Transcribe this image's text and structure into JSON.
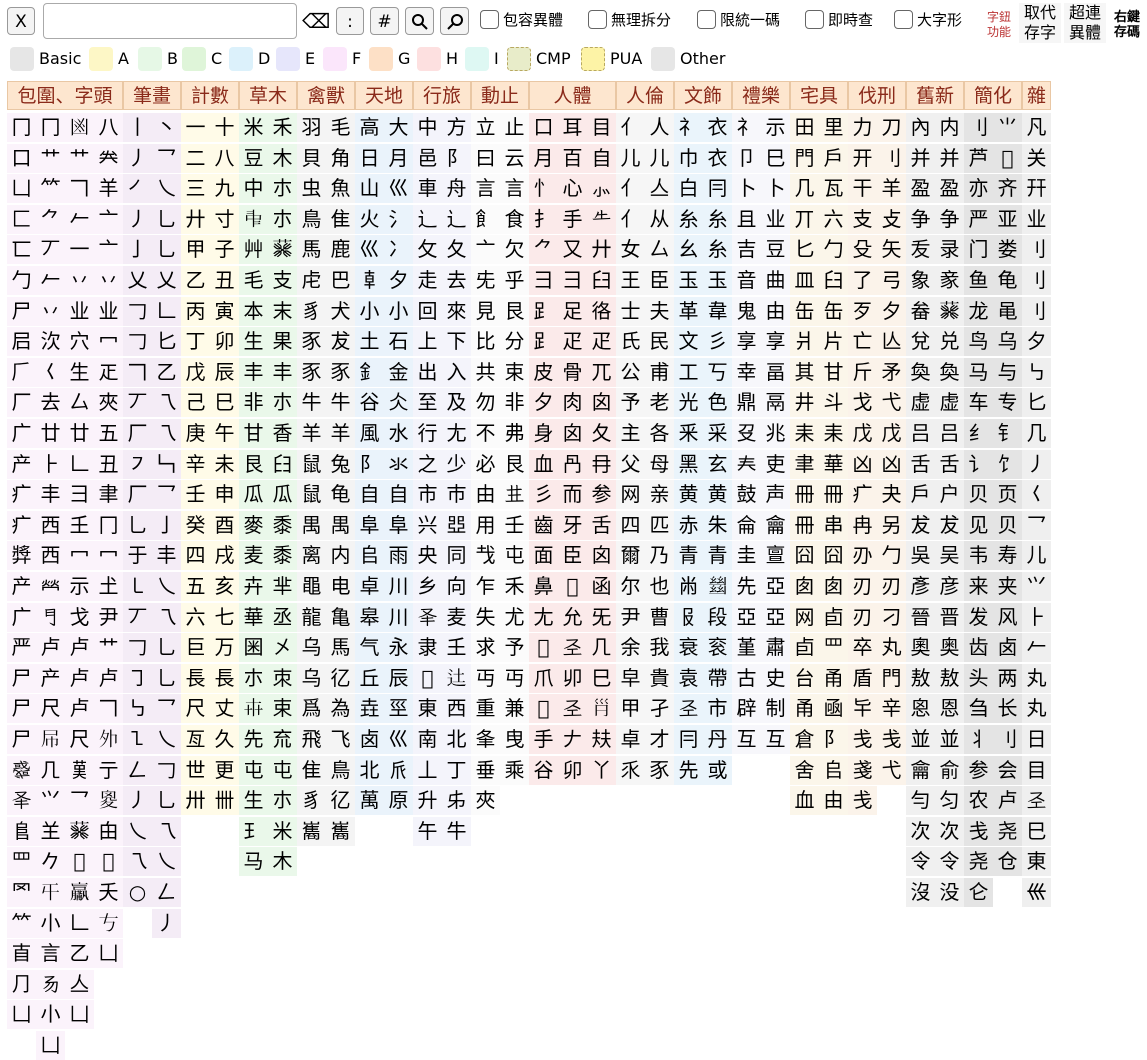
{
  "toolbar": {
    "clear_label": "X",
    "search_value": "",
    "search_placeholder": "",
    "backspace_glyph": "⌫",
    "colon_label": ":",
    "hash_label": "#",
    "search_icon": "magnifier-icon",
    "search_alt_icon": "magnifier-alt-icon",
    "options": [
      {
        "label": "包容異體",
        "checked": false
      },
      {
        "label": "無理拆分",
        "checked": false
      },
      {
        "label": "限統一碼",
        "checked": false
      },
      {
        "label": "即時查",
        "checked": false
      },
      {
        "label": "大字形",
        "checked": false
      }
    ],
    "right_buttons": {
      "func": [
        "字鈕",
        "功能"
      ],
      "replace": [
        "取代",
        "存字"
      ],
      "link": [
        "超連",
        "異體"
      ],
      "rightkey": [
        "右鍵",
        "存碼"
      ]
    }
  },
  "filters": [
    {
      "label": "Basic",
      "color": "#e6e6e6",
      "dashed": false
    },
    {
      "label": "A",
      "color": "#fdf7c6",
      "dashed": false
    },
    {
      "label": "B",
      "color": "#e6f8e6",
      "dashed": false
    },
    {
      "label": "C",
      "color": "#dff5d9",
      "dashed": false
    },
    {
      "label": "D",
      "color": "#dcf1fb",
      "dashed": false
    },
    {
      "label": "E",
      "color": "#e6e6fb",
      "dashed": false
    },
    {
      "label": "F",
      "color": "#fbe6fb",
      "dashed": false
    },
    {
      "label": "G",
      "color": "#fde0c6",
      "dashed": false
    },
    {
      "label": "H",
      "color": "#fde0e0",
      "dashed": false
    },
    {
      "label": "I",
      "color": "#def8f3",
      "dashed": false
    },
    {
      "label": "CMP",
      "color": "#e8ecc9",
      "dashed": true
    },
    {
      "label": "PUA",
      "color": "#fdf3a6",
      "dashed": true
    },
    {
      "label": "Other",
      "color": "#e6e6e6",
      "dashed": false
    }
  ],
  "categories": [
    {
      "label": "包圍、字頭",
      "bg": "#fbf3fb",
      "columns": [
        "冂口凵匚匸勹尸𡰪𠂆厂广产疒疒㢡产广严尸尸尸𢨋𠬤𨸏罒罓𥫗𥃭⺆凵",
        "冂艹⺮⺈丆𠂉丷㳄𡿨去廿⺊丰西西𤇾𠃛卢产尺𡰯𠘧⺍𦍌𠂊𡕒𡭔言𠃓𡭔凵",
        "𠚍艹𠃍𠂉一丷业穴生厶廿𠃊⺕𡈼冖示戈卢卢卢尺𦰩乛𦮙𤰔𤰑𠃊乙亼凵",
        "八𠔉羊亠亠丷业冖𤴓夾五丑聿冂冖𡈽尹艹卢𠃍𡖄亍𡕩甶𠂌夭𠀁凵"
      ]
    },
    {
      "label": "筆畫",
      "bg": "#f4ecf6",
      "columns": [
        "丨丿㇒丿亅乂𠃌𠃌𠃍丆厂㇇厂乚于㇄丆𠃌㇆㇉㇅𠃋丿乀乁○",
        "丶乛乀乚乚乂𠃊匕乙乁乁𠃑乛亅丰乀乁乚乚乛乀𠃌乚乁乀𠃋⼃"
      ]
    },
    {
      "label": "計數",
      "bg": "#fffbe8",
      "columns": [
        "一二三廾甲乙丙丁戊己庚辛壬癸四五六巨長尺亙世卅",
        "十八九寸子丑寅卯辰巳午未申酉戌亥七万長丈久更卌"
      ]
    },
    {
      "label": "草木",
      "bg": "#eaf8ea",
      "columns": [
        "米豆中𠁩艸毛本生丰非甘艮瓜麥麦卉華𡇒朩𠦃先屯生𤣩马",
        "禾木朩朩𦮙支末果丰朩香𦥑瓜黍黍芈丞㐅朿束㐬屯朩米木"
      ]
    },
    {
      "label": "禽獸",
      "bg": "#f4f4f4",
      "columns": [
        "羽貝虫鳥馬虍豸豕豕牛羊鼠鼠禺离黽龍乌乌爲飛隹豸巂",
        "毛角魚隹鹿巴犬犮豕牛羊兔龟禺内电亀馬𢒼為飞鳥𢒼巂"
      ]
    },
    {
      "label": "天地",
      "bg": "#eaf3fb",
      "columns": [
        "高日山火巛𠦝小土釒谷風阝自阜𠂤卓皋气丘垚卤北萬",
        "大月巛氵冫夕小石金仌水氺自阜雨川川永辰巠巛𠂢原"
      ]
    },
    {
      "label": "行旅",
      "bg": "#f4f4fb",
      "columns": [
        "中邑車辶攵走回上出至行之市兴央乡𠬤隶𢍉東南丄升午",
        "方阝舟⻌夂去來下入及尢少巿𠁁同向麦𡈼𨑒西北丁𠂔牛"
      ]
    },
    {
      "label": "動止",
      "bg": "#fbfbfb",
      "columns": [
        "立曰言飠亠兂見比共勿不必由用𢦏乍失求丏重夆垂夾",
        "止云言食欠乎艮分束非弗艮𠀎壬屯禾尤予丏兼曳乘"
      ]
    },
    {
      "label": "人體",
      "bg": "#fbeaea",
      "columns": [
        "口月忄扌⺈彐𧾷𧾷皮夕身血彡齒面鼻尢𦏲爪𤰔手谷",
        "耳百心手又彐足疋骨肉囟冎而牙臣𠚕允𢀖𠨍𢀖𠂇卯",
        "目自⺗𠂒廾臼𢓜疋兀囟夂冄参舌囟函旡𠘧巳𡿩㚘丫"
      ]
    },
    {
      "label": "人倫",
      "bg": "#f6f6f6",
      "columns": [
        "亻儿亻亻女王士氏公予主父网四爾尔尹余皁甲卓乑",
        "人儿亼从厶臣夫民甫老各母亲匹乃也曹我貴孑才豕"
      ]
    },
    {
      "label": "文飾",
      "bg": "#eaf4fb",
      "columns": [
        "礻巾白糸幺玉革文工光釆黑黄赤青㡀𠬝衰袁𢀖冃先",
        "衣⾐冃糸糸玉韋彡丂色采玄黄朱青𢇍段衮帶市丹或"
      ]
    },
    {
      "label": "禮樂",
      "bg": "#f7f7fb",
      "columns": [
        "礻卩卜且吉音鬼享幸鼎𠬛𡗗鼓侖圭先亞堇古辟互",
        "示巳卜业豆曲由享畐鬲兆吏声龠亶亞亞肅史制互"
      ]
    },
    {
      "label": "宅具",
      "bg": "#fbf6ea",
      "columns": [
        "田門几丌匕皿缶爿其井耒聿冊冊囧囱网卣台甬倉舍血",
        "里戶瓦六勹臼缶片甘斗耒華冊串囧囱卣罒甬凾阝𠂤由"
      ]
    },
    {
      "label": "伐刑",
      "bg": "#fbf3ea",
      "columns": [
        "力开干支殳了歹亡斤戈戊凶疒冉刅刃刃卒盾𠤏戋戔戋",
        "刀刂羊攴矢弓夕亾矛弋戊凶夬另勹刃刁丸門辛戋弋"
      ]
    },
    {
      "label": "舊新",
      "bg": "#f0f0f0",
      "columns": [
        "內并盈争叐象畚兌奐虚吕舌戶犮吳彥晉奧敖恖並龠勻次令沒",
        "内并盈争录豙𦮙兑奐虚吕舌户犮吴彦晋奥敖恩並俞匀次令没"
      ]
    },
    {
      "label": "簡化",
      "bg": "#e4e4e4",
      "columns": [
        "刂芦亦严门鱼龙鸟马车纟讠贝见韦来发齿头刍丬参农戋尧仑",
        "⺌𠠳齐亚娄龟黾乌与专钅饣页贝寿夹风卤两长刂会卢尧仓"
      ]
    },
    {
      "label": "雜",
      "bg": "#efefef",
      "columns": [
        "凡关幵业刂刂刂夕㇉匕几丿𡿨⺂儿⺍⺊𠂉丸丸日目𢀖巳東𡿧"
      ]
    }
  ]
}
